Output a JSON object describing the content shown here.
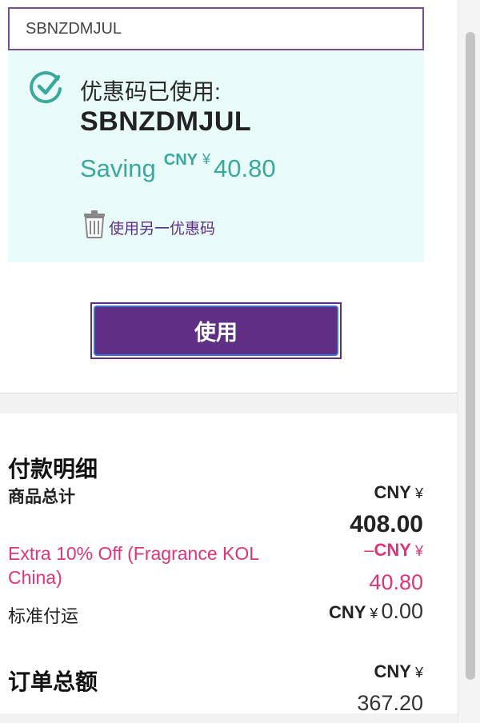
{
  "promo": {
    "input_value": "SBNZDMJUL",
    "applied_title": "优惠码已使用:",
    "applied_code": "SBNZDMJUL",
    "saving_label": "Saving",
    "saving_currency": "CNY",
    "saving_symbol": "¥",
    "saving_amount": "40.80",
    "remove_label": "使用另一优惠码",
    "apply_button": "使用"
  },
  "summary": {
    "title": "付款明细",
    "subtotal_label": "商品总计",
    "subtotal_currency": "CNY",
    "subtotal_symbol": "¥",
    "subtotal_value": "408.00",
    "discount_label": "Extra 10% Off (Fragrance KOL China)",
    "discount_prefix": "–",
    "discount_currency": "CNY",
    "discount_symbol": "¥",
    "discount_value": "40.80",
    "shipping_label": "标准付运",
    "shipping_currency": "CNY",
    "shipping_symbol": "¥",
    "shipping_value": "0.00",
    "total_label": "订单总额",
    "total_currency": "CNY",
    "total_symbol": "¥",
    "total_value": "367.20"
  },
  "colors": {
    "accent_purple": "#5e2f84",
    "success_teal": "#3ba89c",
    "discount_pink": "#e0347a",
    "applied_bg": "#e8fbf9",
    "top_tab_orange": "#ff7a1f"
  },
  "icons": {
    "check": "check-circle-icon",
    "trash": "trash-icon"
  }
}
